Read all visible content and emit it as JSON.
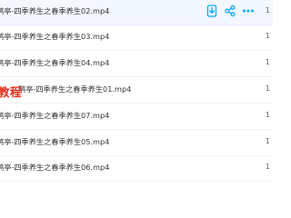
{
  "files": [
    {
      "name": "鹊亭-四季养生之春季养生02.mp4",
      "size": "1"
    },
    {
      "name": "鹊亭-四季养生之春季养生03.mp4",
      "size": "1"
    },
    {
      "name": "鹊亭-四季养生之春季养生04.mp4",
      "size": "1"
    },
    {
      "name": "鹊亭-四季养生之春季养生01.mp4",
      "size": "1"
    },
    {
      "name": "鹊亭-四季养生之春季养生07.mp4",
      "size": "1"
    },
    {
      "name": "鹊亭-四季养生之春季养生05.mp4",
      "size": "1"
    },
    {
      "name": "鹊亭-四季养生之春季养生06.mp4",
      "size": "1"
    }
  ],
  "overlay_text": "教程",
  "row_actions": {
    "icons": [
      "download-icon",
      "share-icon",
      "more-icon"
    ],
    "more_label": "•••"
  },
  "colors": {
    "accent": "#06a7ff",
    "hover_row": "#f3f7ff",
    "watermark": "#e62b1b",
    "text": "#333333"
  }
}
